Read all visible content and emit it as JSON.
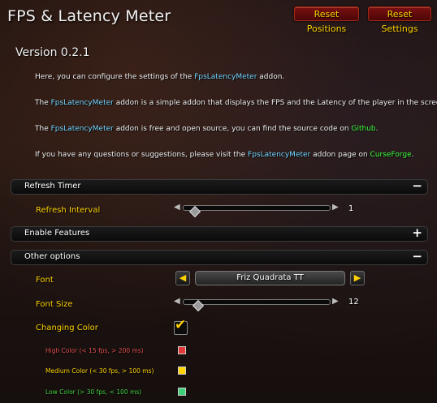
{
  "header": {
    "title": "FPS & Latency Meter",
    "reset_positions_label": "Reset Positions",
    "reset_settings_label": "Reset Settings"
  },
  "version": "Version 0.2.1",
  "intro": {
    "p1": {
      "a": "Here, you can configure the settings of the ",
      "addon": "FpsLatencyMeter",
      "b": " addon."
    },
    "p2": {
      "a": "The ",
      "addon": "FpsLatencyMeter",
      "b": " addon is a simple addon that displays the FPS and the Latency of the player in the screen."
    },
    "p3": {
      "a": "The ",
      "addon": "FpsLatencyMeter",
      "b": " addon is free and open source, you can find the source code on ",
      "link": "Github",
      "c": "."
    },
    "p4": {
      "a": "If you have any questions or suggestions, please visit the ",
      "addon": "FpsLatencyMeter",
      "b": " addon page on ",
      "link": "CurseForge",
      "c": "."
    }
  },
  "sections": {
    "refresh": {
      "label": "Refresh Timer",
      "toggle": "−",
      "expanded": true
    },
    "enable": {
      "label": "Enable Features",
      "toggle": "+",
      "expanded": false
    },
    "other": {
      "label": "Other options",
      "toggle": "−",
      "expanded": true
    }
  },
  "refresh_interval": {
    "label": "Refresh Interval",
    "value": "1",
    "level": 0.08
  },
  "font": {
    "label": "Font",
    "value": "Friz Quadrata TT",
    "left_icon": "left-triangle-icon",
    "right_icon": "right-triangle-icon"
  },
  "font_size": {
    "label": "Font Size",
    "value": "12",
    "level": 0.1
  },
  "changing_color": {
    "label": "Changing Color",
    "checked": true
  },
  "colors": {
    "high": {
      "label": "High Color (< 15 fps, > 200 ms)",
      "color": "#e23a3a",
      "text_color": "#e05050"
    },
    "medium": {
      "label": "Medium Color (< 30 fps, > 100 ms)",
      "color": "#ffd200",
      "text_color": "#ffd200"
    },
    "low": {
      "label": "Low Color (> 30 fps, < 100 ms)",
      "color": "#3fd17a",
      "text_color": "#40d040"
    }
  }
}
